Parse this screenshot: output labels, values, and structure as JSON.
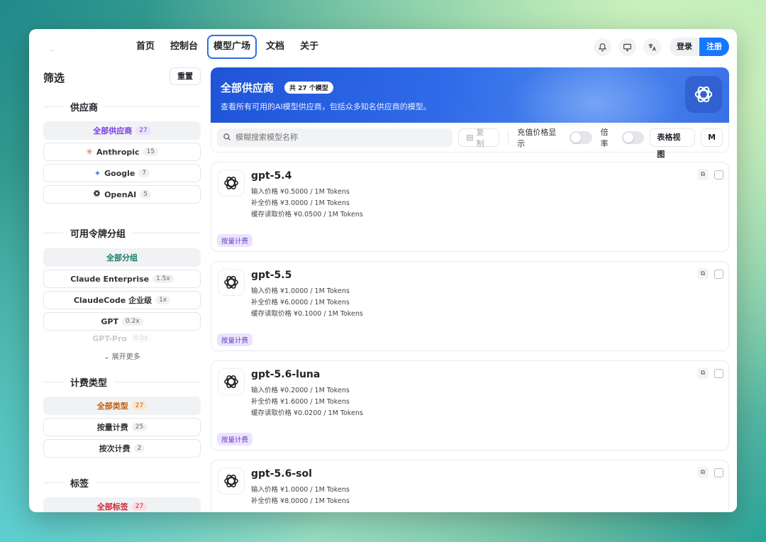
{
  "nav": {
    "logo_text": "...",
    "items": [
      {
        "label": "首页",
        "active": false
      },
      {
        "label": "控制台",
        "active": false
      },
      {
        "label": "模型广场",
        "active": true
      },
      {
        "label": "文档",
        "active": false
      },
      {
        "label": "关于",
        "active": false
      }
    ],
    "icons": [
      "bell-icon",
      "monitor-icon",
      "translate-icon"
    ],
    "login_label": "登录",
    "register_label": "注册",
    "accent_color": "#1677ff"
  },
  "sidebar": {
    "title": "筛选",
    "reset_label": "重置",
    "providers": {
      "title": "供应商",
      "options": [
        {
          "label": "全部供应商",
          "count": "27",
          "selected": true
        },
        {
          "label": "Anthropic",
          "count": "15",
          "icon": "anthropic-icon"
        },
        {
          "label": "Google",
          "count": "7",
          "icon": "gemini-icon"
        },
        {
          "label": "OpenAI",
          "count": "5",
          "icon": "openai-icon"
        }
      ]
    },
    "groups": {
      "title": "可用令牌分组",
      "options": [
        {
          "label": "全部分组",
          "selected": true
        },
        {
          "label": "Claude Enterprise",
          "count": "1.5x"
        },
        {
          "label": "ClaudeCode 企业级",
          "count": "1x"
        },
        {
          "label": "GPT",
          "count": "0.2x"
        },
        {
          "label": "GPT-Pro",
          "count": "0.5x"
        }
      ],
      "expand_label": "展开更多"
    },
    "billing": {
      "title": "计费类型",
      "options": [
        {
          "label": "全部类型",
          "count": "27",
          "selected": true
        },
        {
          "label": "按量计费",
          "count": "25"
        },
        {
          "label": "按次计费",
          "count": "2"
        }
      ]
    },
    "tags": {
      "title": "标签",
      "options": [
        {
          "label": "全部标签",
          "count": "27",
          "selected": true
        }
      ]
    }
  },
  "hero": {
    "title": "全部供应商",
    "badge": "共 27 个模型",
    "description": "查看所有可用的AI模型供应商，包括众多知名供应商的模型。"
  },
  "toolbar": {
    "search_placeholder": "模糊搜索模型名称",
    "copy_label": "复制",
    "recharge_price_label": "充值价格显示",
    "ratio_label": "倍率",
    "table_view_label": "表格视图",
    "m_label": "M"
  },
  "models": [
    {
      "name": "gpt-5.4",
      "input_price": "输入价格 ¥0.5000 / 1M Tokens",
      "completion_price": "补全价格 ¥3.0000 / 1M Tokens",
      "cache_price": "缓存读取价格 ¥0.0500 / 1M Tokens",
      "tag": "按量计费"
    },
    {
      "name": "gpt-5.5",
      "input_price": "输入价格 ¥1.0000 / 1M Tokens",
      "completion_price": "补全价格 ¥6.0000 / 1M Tokens",
      "cache_price": "缓存读取价格 ¥0.1000 / 1M Tokens",
      "tag": "按量计费"
    },
    {
      "name": "gpt-5.6-luna",
      "input_price": "输入价格 ¥0.2000 / 1M Tokens",
      "completion_price": "补全价格 ¥1.6000 / 1M Tokens",
      "cache_price": "缓存读取价格 ¥0.0200 / 1M Tokens",
      "tag": "按量计费"
    },
    {
      "name": "gpt-5.6-sol",
      "input_price": "输入价格 ¥1.0000 / 1M Tokens",
      "completion_price": "补全价格 ¥8.0000 / 1M Tokens",
      "cache_price": "",
      "tag": ""
    }
  ]
}
